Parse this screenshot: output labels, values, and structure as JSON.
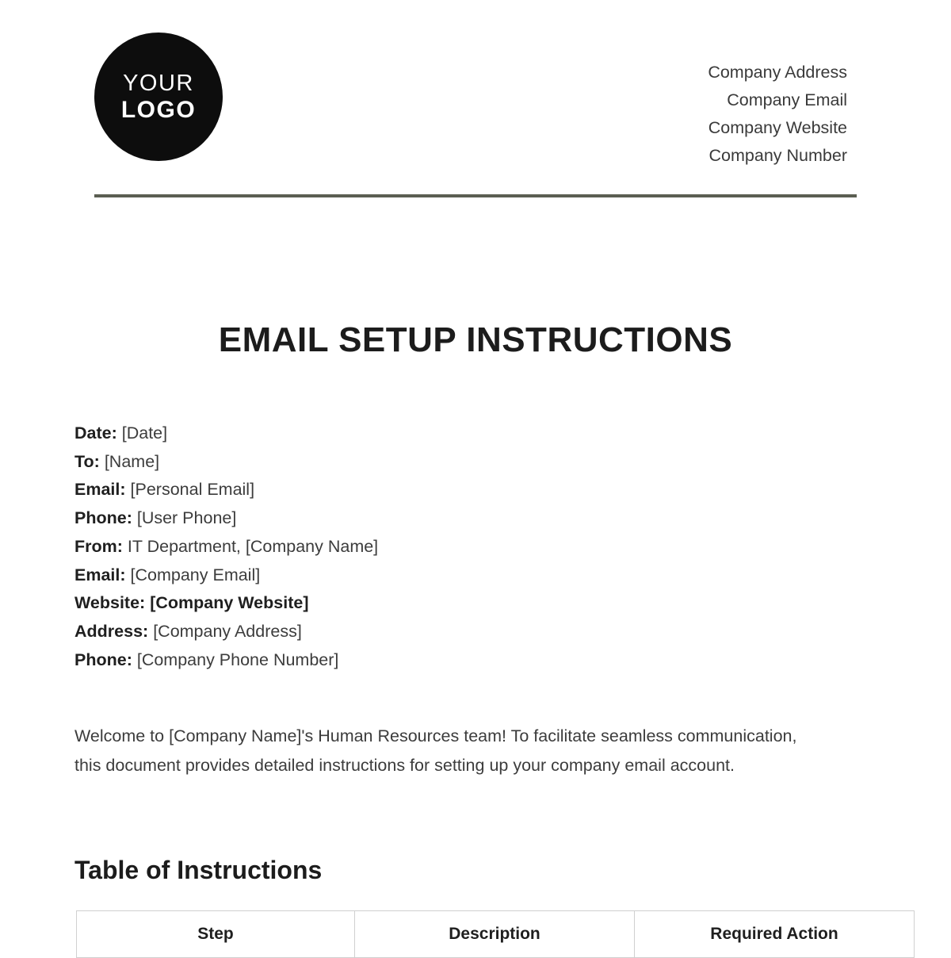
{
  "header": {
    "logo": {
      "line1": "YOUR",
      "line2": "LOGO"
    },
    "company_info": [
      "Company Address",
      "Company Email",
      "Company Website",
      "Company Number"
    ]
  },
  "document": {
    "title": "EMAIL SETUP INSTRUCTIONS",
    "meta": [
      {
        "label": "Date:",
        "value": "[Date]",
        "bold_value": false
      },
      {
        "label": "To:",
        "value": "[Name]",
        "bold_value": false
      },
      {
        "label": "Email:",
        "value": "[Personal Email]",
        "bold_value": false
      },
      {
        "label": "Phone:",
        "value": "[User Phone]",
        "bold_value": false
      },
      {
        "label": "From:",
        "value": "IT Department, [Company Name]",
        "bold_value": false
      },
      {
        "label": "Email:",
        "value": "[Company Email]",
        "bold_value": false
      },
      {
        "label": "Website:",
        "value": "[Company Website]",
        "bold_value": true
      },
      {
        "label": "Address:",
        "value": "[Company Address]",
        "bold_value": false
      },
      {
        "label": "Phone:",
        "value": "[Company Phone Number]",
        "bold_value": false
      }
    ],
    "intro": "Welcome to [Company Name]'s Human Resources team! To facilitate seamless communication, this document provides detailed instructions for setting up your company email account.",
    "section_heading": "Table of Instructions",
    "table": {
      "columns": [
        "Step",
        "Description",
        "Required Action"
      ],
      "rows": []
    }
  },
  "colors": {
    "rule": "#5b5e52",
    "logo_bg": "#0d0d0d",
    "text": "#3c3c3c",
    "heading": "#1c1c1c",
    "table_border": "#d0d0d0"
  }
}
